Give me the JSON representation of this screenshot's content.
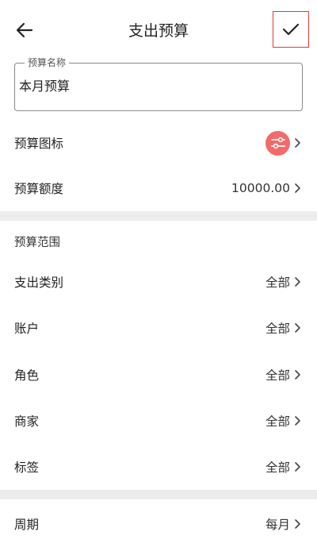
{
  "appbar": {
    "title": "支出预算"
  },
  "name_field": {
    "label": "预算名称",
    "value": "本月预算"
  },
  "icon_row": {
    "label": "预算图标",
    "icon": "sliders-icon",
    "icon_color": "#f26a6a"
  },
  "amount_row": {
    "label": "预算额度",
    "value": "10000.00"
  },
  "scope": {
    "title": "预算范围",
    "rows": [
      {
        "label": "支出类别",
        "value": "全部"
      },
      {
        "label": "账户",
        "value": "全部"
      },
      {
        "label": "角色",
        "value": "全部"
      },
      {
        "label": "商家",
        "value": "全部"
      },
      {
        "label": "标签",
        "value": "全部"
      }
    ]
  },
  "period_row": {
    "label": "周期",
    "value": "每月"
  },
  "colors": {
    "divider": "#ececec",
    "highlight": "#e03a3a"
  }
}
